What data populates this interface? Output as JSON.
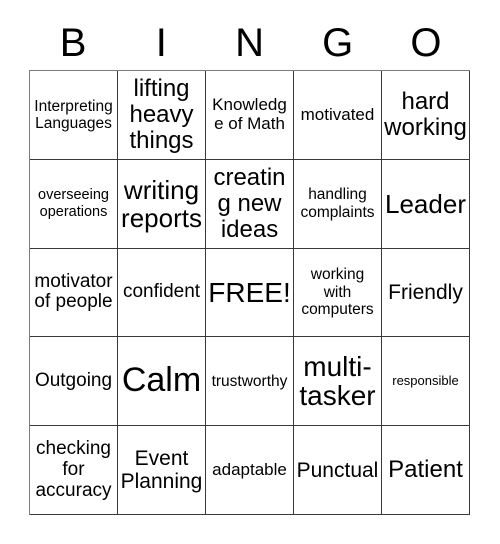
{
  "header": {
    "letters": [
      "B",
      "I",
      "N",
      "G",
      "O"
    ]
  },
  "grid": {
    "rows": 5,
    "columns": 5,
    "border_color": "#3a3a3a",
    "background_color": "#ffffff",
    "text_color": "#000000",
    "cells": [
      [
        {
          "text": "Interpreting Languages",
          "size": "fs-15"
        },
        {
          "text": "lifting heavy things",
          "size": "fs-24"
        },
        {
          "text": "Knowledge of Math",
          "size": "fs-17"
        },
        {
          "text": "motivated",
          "size": "fs-17"
        },
        {
          "text": "hard working",
          "size": "fs-24"
        }
      ],
      [
        {
          "text": "overseeing operations",
          "size": "fs-14"
        },
        {
          "text": "writing reports",
          "size": "fs-26"
        },
        {
          "text": "creating new ideas",
          "size": "fs-24"
        },
        {
          "text": "handling complaints",
          "size": "fs-15"
        },
        {
          "text": "Leader",
          "size": "fs-26"
        }
      ],
      [
        {
          "text": "motivator of people",
          "size": "fs-19"
        },
        {
          "text": "confident",
          "size": "fs-19"
        },
        {
          "text": "FREE!",
          "size": "fs-28"
        },
        {
          "text": "working with computers",
          "size": "fs-15"
        },
        {
          "text": "Friendly",
          "size": "fs-21"
        }
      ],
      [
        {
          "text": "Outgoing",
          "size": "fs-19"
        },
        {
          "text": "Calm",
          "size": "fs-34"
        },
        {
          "text": "trustworthy",
          "size": "fs-15"
        },
        {
          "text": "multi-tasker",
          "size": "fs-28"
        },
        {
          "text": "responsible",
          "size": "fs-13"
        }
      ],
      [
        {
          "text": "checking for accuracy",
          "size": "fs-19"
        },
        {
          "text": "Event Planning",
          "size": "fs-21"
        },
        {
          "text": "adaptable",
          "size": "fs-17"
        },
        {
          "text": "Punctual",
          "size": "fs-21"
        },
        {
          "text": "Patient",
          "size": "fs-24"
        }
      ]
    ]
  }
}
